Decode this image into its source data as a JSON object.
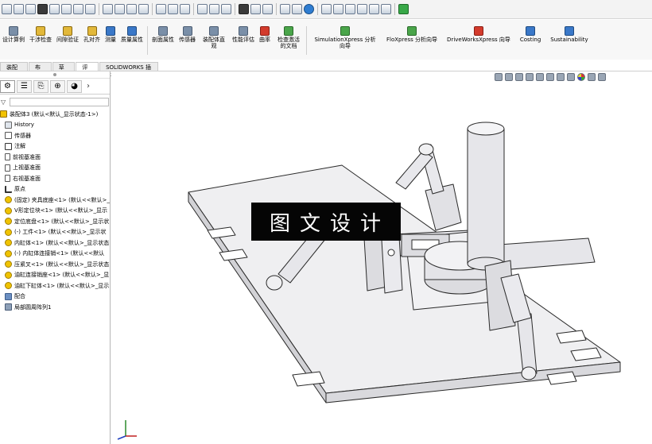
{
  "ribbon": {
    "commands": [
      {
        "label": "设计算例",
        "icon": "design-study-icon"
      },
      {
        "label": "干涉检查",
        "icon": "interference-icon"
      },
      {
        "label": "间隙验证",
        "icon": "clearance-icon"
      },
      {
        "label": "孔对齐",
        "icon": "hole-align-icon"
      },
      {
        "label": "测量",
        "icon": "measure-icon"
      },
      {
        "label": "质量属性",
        "icon": "mass-properties-icon"
      },
      {
        "label": "剖面属性",
        "icon": "section-properties-icon"
      },
      {
        "label": "传感器",
        "icon": "sensor-icon"
      },
      {
        "label": "装配体直观",
        "icon": "assembly-visualization-icon"
      },
      {
        "label": "性能评估",
        "icon": "performance-evaluation-icon"
      },
      {
        "label": "曲率",
        "icon": "curvature-icon"
      },
      {
        "label": "检查激活的文档",
        "icon": "check-document-icon"
      },
      {
        "label": "SimulationXpress 分析向导",
        "icon": "simulationxpress-icon"
      },
      {
        "label": "FloXpress 分析向导",
        "icon": "floxpress-icon"
      },
      {
        "label": "DriveWorksXpress 向导",
        "icon": "driveworksxpress-icon"
      },
      {
        "label": "Costing",
        "icon": "costing-icon"
      },
      {
        "label": "Sustainability",
        "icon": "sustainability-icon"
      }
    ]
  },
  "tabs": [
    "装配体",
    "布局",
    "草图",
    "评估",
    "SOLIDWORKS 插件"
  ],
  "active_tab": "评估",
  "tree": {
    "root": "装配体3 (默认<默认_显示状态-1>)",
    "items": [
      {
        "label": "History",
        "icon": "history-icon"
      },
      {
        "label": "传感器",
        "icon": "sensor-icon"
      },
      {
        "label": "注解",
        "icon": "annotation-icon"
      },
      {
        "label": "前视基准面",
        "icon": "plane-icon"
      },
      {
        "label": "上视基准面",
        "icon": "plane-icon"
      },
      {
        "label": "右视基准面",
        "icon": "plane-icon"
      },
      {
        "label": "原点",
        "icon": "origin-icon"
      },
      {
        "label": "(固定) 夹具底座<1> (默认<<默认>_",
        "icon": "part-icon"
      },
      {
        "label": "V形定位块<1> (默认<<默认>_显示",
        "icon": "part-icon"
      },
      {
        "label": "定位底盘<1> (默认<<默认>_显示状",
        "icon": "part-icon"
      },
      {
        "label": "(-) 工件<1> (默认<<默认>_显示状",
        "icon": "part-icon"
      },
      {
        "label": "内缸体<1> (默认<<默认>_显示状态",
        "icon": "part-icon"
      },
      {
        "label": "(-) 内缸体连接销<1> (默认<<默认",
        "icon": "part-icon"
      },
      {
        "label": "压紧叉<1> (默认<<默认>_显示状态",
        "icon": "part-icon"
      },
      {
        "label": "油缸连接销座<1> (默认<<默认>_显",
        "icon": "part-icon"
      },
      {
        "label": "油缸下缸体<1> (默认<<默认>_显示",
        "icon": "part-icon"
      },
      {
        "label": "配合",
        "icon": "mate-icon"
      },
      {
        "label": "局部圆周阵列1",
        "icon": "pattern-icon"
      }
    ]
  },
  "watermark": "图文设计",
  "colors": {
    "toolbar_bg": "#f3f3f3",
    "viewport_bg": "#ffffff",
    "model_fill": "#e9e9ec",
    "model_edge": "#2a2a2a",
    "watermark_bg": "#050505"
  }
}
